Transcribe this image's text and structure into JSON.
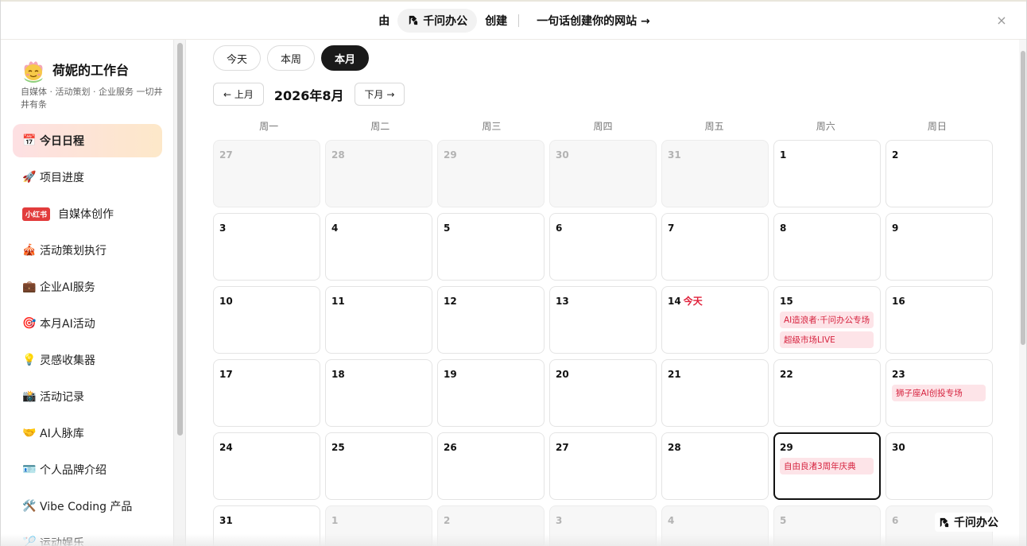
{
  "banner": {
    "by": "由",
    "brand": "千问办公",
    "create": "创建",
    "cta": "一句话创建你的网站 →",
    "close": "×"
  },
  "profile": {
    "name": "荷妮的工作台",
    "desc": "自媒体 · 活动策划 · 企业服务 一切井井有条"
  },
  "nav": [
    {
      "icon": "📅",
      "label": "今日日程",
      "active": true
    },
    {
      "icon": "🚀",
      "label": "项目进度"
    },
    {
      "badge": "小红书",
      "label": "自媒体创作"
    },
    {
      "icon": "🎪",
      "label": "活动策划执行"
    },
    {
      "icon": "💼",
      "label": "企业AI服务"
    },
    {
      "icon": "🎯",
      "label": "本月AI活动"
    },
    {
      "icon": "💡",
      "label": "灵感收集器"
    },
    {
      "icon": "📸",
      "label": "活动记录"
    },
    {
      "icon": "🤝",
      "label": "AI人脉库"
    },
    {
      "icon": "🪪",
      "label": "个人品牌介绍"
    },
    {
      "icon": "🛠️",
      "label": "Vibe Coding 产品"
    },
    {
      "icon": "🏸",
      "label": "运动娱乐"
    }
  ],
  "view_tabs": [
    {
      "label": "今天"
    },
    {
      "label": "本周"
    },
    {
      "label": "本月",
      "active": true
    }
  ],
  "month_nav": {
    "prev": "← 上月",
    "title": "2026年8月",
    "next": "下月 →"
  },
  "weekdays": [
    "周一",
    "周二",
    "周三",
    "周四",
    "周五",
    "周六",
    "周日"
  ],
  "today_label": "今天",
  "days": [
    {
      "d": "27",
      "outside": true
    },
    {
      "d": "28",
      "outside": true
    },
    {
      "d": "29",
      "outside": true
    },
    {
      "d": "30",
      "outside": true
    },
    {
      "d": "31",
      "outside": true
    },
    {
      "d": "1"
    },
    {
      "d": "2"
    },
    {
      "d": "3"
    },
    {
      "d": "4"
    },
    {
      "d": "5"
    },
    {
      "d": "6"
    },
    {
      "d": "7"
    },
    {
      "d": "8"
    },
    {
      "d": "9"
    },
    {
      "d": "10"
    },
    {
      "d": "11"
    },
    {
      "d": "12"
    },
    {
      "d": "13"
    },
    {
      "d": "14",
      "today": true
    },
    {
      "d": "15",
      "events": [
        "AI造浪者·千问办公专场",
        "超级市场LIVE"
      ]
    },
    {
      "d": "16"
    },
    {
      "d": "17"
    },
    {
      "d": "18"
    },
    {
      "d": "19"
    },
    {
      "d": "20"
    },
    {
      "d": "21"
    },
    {
      "d": "22"
    },
    {
      "d": "23",
      "events": [
        "狮子座AI创投专场"
      ]
    },
    {
      "d": "24"
    },
    {
      "d": "25"
    },
    {
      "d": "26"
    },
    {
      "d": "27"
    },
    {
      "d": "28"
    },
    {
      "d": "29",
      "selected": true,
      "events": [
        "自由良渚3周年庆典"
      ]
    },
    {
      "d": "30"
    },
    {
      "d": "31"
    },
    {
      "d": "1",
      "outside": true
    },
    {
      "d": "2",
      "outside": true
    },
    {
      "d": "3",
      "outside": true
    },
    {
      "d": "4",
      "outside": true
    },
    {
      "d": "5",
      "outside": true
    },
    {
      "d": "6",
      "outside": true
    }
  ],
  "watermark": "千问办公"
}
